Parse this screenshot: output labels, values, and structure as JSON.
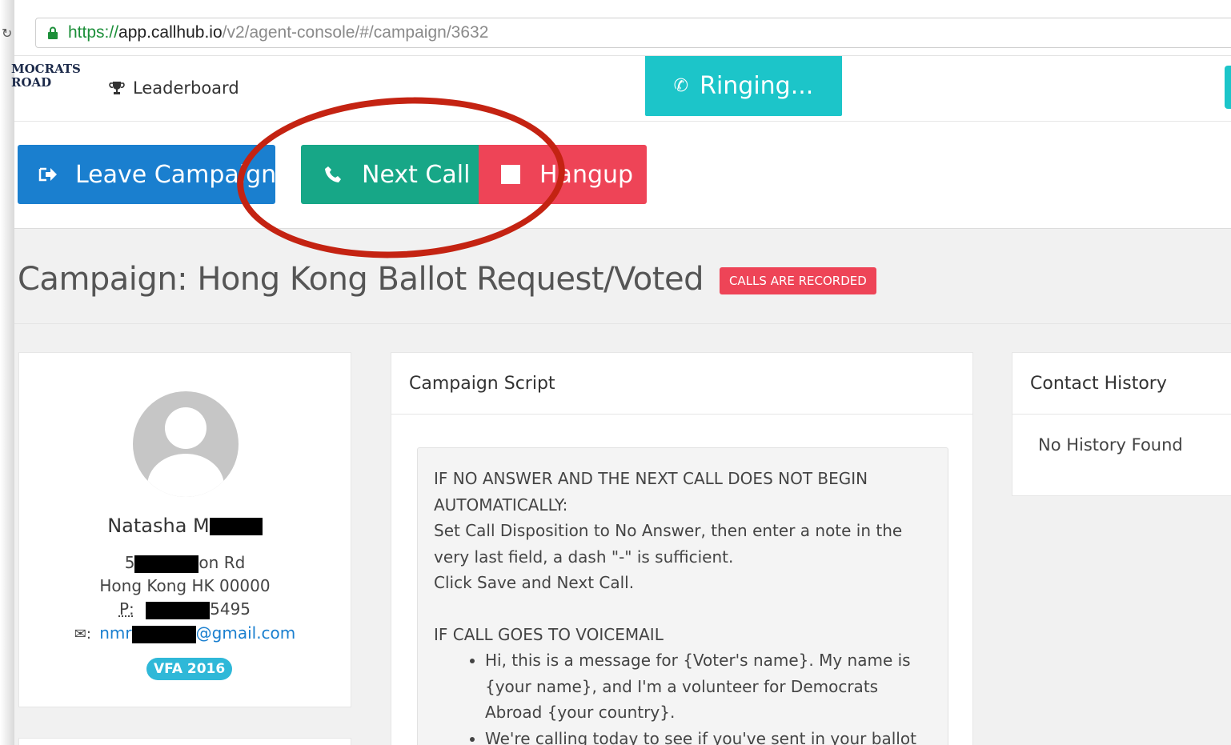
{
  "browser": {
    "url_scheme": "https://",
    "url_host": "app.callhub.io",
    "url_path": "/v2/agent-console/#/campaign/3632"
  },
  "header": {
    "logo_line1": "MOCRATS",
    "logo_line2": "ROAD",
    "leaderboard_label": "Leaderboard",
    "call_status": "Ringing..."
  },
  "toolbar": {
    "leave_label": "Leave Campaign",
    "next_call_label": "Next Call",
    "hangup_label": "Hangup"
  },
  "campaign": {
    "title": "Campaign: Hong Kong Ballot Request/Voted",
    "badge": "CALLS ARE RECORDED"
  },
  "contact": {
    "name_visible": "Natasha M",
    "address_prefix": "5",
    "address_suffix": "on Rd",
    "city_line": "Hong Kong HK 00000",
    "phone_label": "P:",
    "phone_suffix": "5495",
    "email_prefix": "nmr",
    "email_suffix": "@gmail.com",
    "tag": "VFA 2016"
  },
  "script": {
    "header": "Campaign Script",
    "p1_heading": "IF NO ANSWER AND THE NEXT CALL DOES NOT BEGIN AUTOMATICALLY:",
    "p1_line1": "Set Call Disposition to No Answer, then enter a note in the very last field, a dash \"-\" is sufficient.",
    "p1_line2": "Click Save and Next Call.",
    "p2_heading": "IF CALL GOES TO VOICEMAIL",
    "bullets": [
      "Hi, this is a message for {Voter's name}.  My name is {your name}, and I'm a volunteer for Democrats Abroad {your country}.",
      "We're calling today to see if you've sent in your ballot"
    ]
  },
  "history": {
    "header": "Contact History",
    "empty_text": "No History Found"
  },
  "colors": {
    "ringing": "#1cc5c9",
    "leave": "#1a7fcf",
    "next_call": "#17a787",
    "hangup": "#ee4457",
    "annotation": "#c42312"
  }
}
